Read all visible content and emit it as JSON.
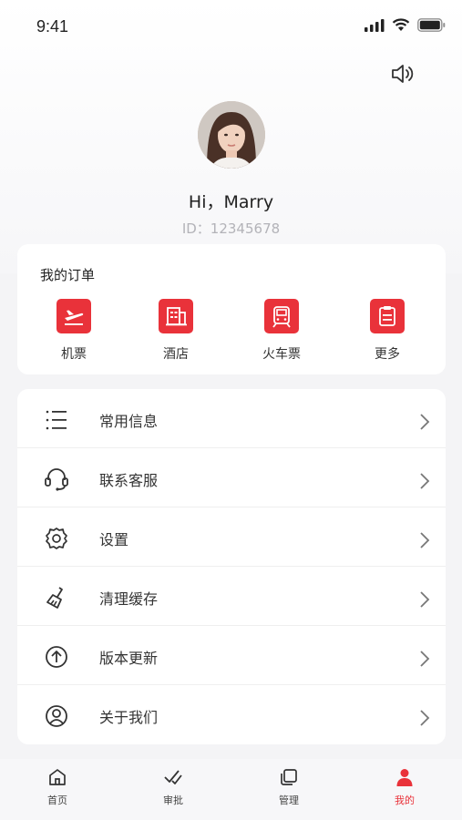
{
  "status_bar": {
    "time": "9:41"
  },
  "profile": {
    "greeting": "Hi，Marry",
    "id_text": "ID：12345678"
  },
  "orders": {
    "title": "我的订单",
    "items": [
      {
        "label": "机票",
        "icon": "plane-icon"
      },
      {
        "label": "酒店",
        "icon": "hotel-icon"
      },
      {
        "label": "火车票",
        "icon": "train-icon"
      },
      {
        "label": "更多",
        "icon": "more-icon"
      }
    ]
  },
  "menu": {
    "items": [
      {
        "label": "常用信息",
        "icon": "list-icon"
      },
      {
        "label": "联系客服",
        "icon": "headset-icon"
      },
      {
        "label": "设置",
        "icon": "gear-icon"
      },
      {
        "label": "清理缓存",
        "icon": "broom-icon"
      },
      {
        "label": "版本更新",
        "icon": "upgrade-icon"
      },
      {
        "label": "关于我们",
        "icon": "user-circle-icon"
      }
    ]
  },
  "tab_bar": {
    "items": [
      {
        "label": "首页",
        "icon": "home-icon"
      },
      {
        "label": "审批",
        "icon": "approve-icon"
      },
      {
        "label": "管理",
        "icon": "manage-icon"
      },
      {
        "label": "我的",
        "icon": "profile-icon",
        "active": true
      }
    ]
  },
  "colors": {
    "accent": "#e9323a",
    "background": "#f4f4f6"
  }
}
